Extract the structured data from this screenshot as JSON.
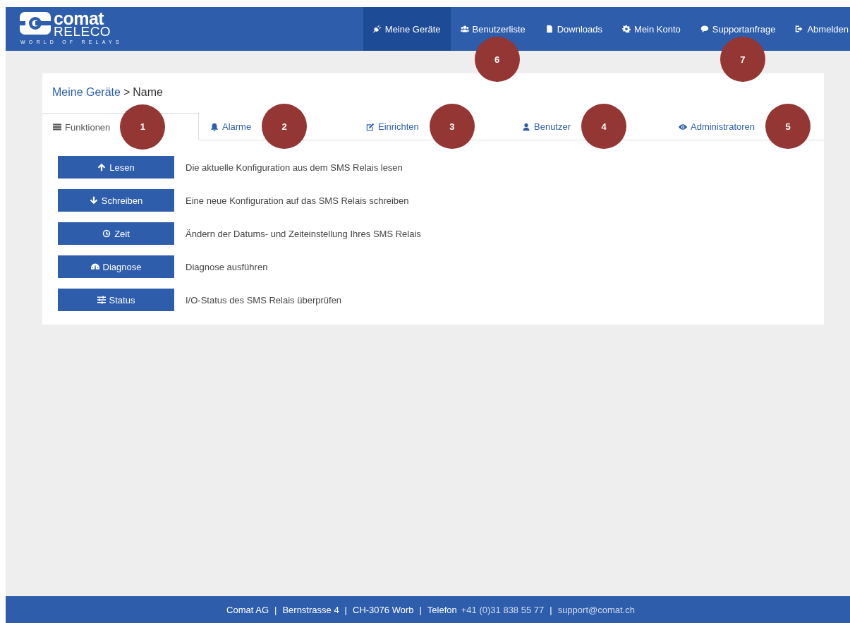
{
  "header": {
    "logo": {
      "name": "comat",
      "sub": "RELECO",
      "tagline": "WORLD OF RELAYS"
    },
    "nav": [
      {
        "label": "Meine Geräte",
        "selected": true
      },
      {
        "label": "Benutzerliste",
        "selected": false,
        "callout": "6"
      },
      {
        "label": "Downloads",
        "selected": false
      },
      {
        "label": "Mein Konto",
        "selected": false
      },
      {
        "label": "Supportanfrage",
        "selected": false,
        "callout": "7"
      },
      {
        "label": "Abmelden",
        "selected": false
      }
    ]
  },
  "breadcrumb": {
    "link": "Meine Geräte",
    "separator": ">",
    "current": "Name"
  },
  "tabs": [
    {
      "label": "Funktionen",
      "selected": true,
      "callout": "1"
    },
    {
      "label": "Alarme",
      "selected": false,
      "callout": "2"
    },
    {
      "label": "Einrichten",
      "selected": false,
      "callout": "3"
    },
    {
      "label": "Benutzer",
      "selected": false,
      "callout": "4"
    },
    {
      "label": "Administratoren",
      "selected": false,
      "callout": "5"
    }
  ],
  "functions": [
    {
      "label": "Lesen",
      "description": "Die aktuelle Konfiguration aus dem SMS Relais lesen"
    },
    {
      "label": "Schreiben",
      "description": "Eine neue Konfiguration auf das SMS Relais schreiben"
    },
    {
      "label": "Zeit",
      "description": "Ändern der Datums- und Zeiteinstellung Ihres SMS Relais"
    },
    {
      "label": "Diagnose",
      "description": "Diagnose ausführen"
    },
    {
      "label": "Status",
      "description": "I/O-Status des SMS Relais überprüfen"
    }
  ],
  "footer": {
    "separator": "|",
    "items": [
      {
        "kind": "text",
        "text": "Comat AG"
      },
      {
        "kind": "text",
        "text": "Bernstrasse 4"
      },
      {
        "kind": "text",
        "text": "CH-3076 Worb"
      },
      {
        "kind": "phone",
        "text": "Telefon",
        "value": "+41 (0)31 838 55 77"
      },
      {
        "kind": "link",
        "text": "support@comat.ch"
      }
    ]
  }
}
